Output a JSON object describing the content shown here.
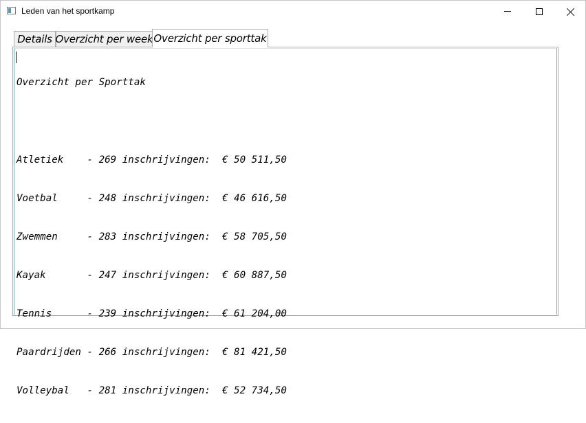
{
  "window": {
    "title": "Leden van het sportkamp",
    "minimize_icon": "minimize-icon",
    "maximize_icon": "maximize-icon",
    "close_icon": "close-icon"
  },
  "tabs": [
    {
      "label": "Details",
      "selected": false
    },
    {
      "label": "Overzicht per week",
      "selected": false
    },
    {
      "label": "Overzicht per sporttak",
      "selected": true
    }
  ],
  "report": {
    "heading": "Overzicht per Sporttak",
    "blank": "",
    "rows": [
      "Atletiek    - 269 inschrijvingen:  € 50 511,50",
      "Voetbal     - 248 inschrijvingen:  € 46 616,50",
      "Zwemmen     - 283 inschrijvingen:  € 58 705,50",
      "Kayak       - 247 inschrijvingen:  € 60 887,50",
      "Tennis      - 239 inschrijvingen:  € 61 204,00",
      "Paardrijden - 266 inschrijvingen:  € 81 421,50",
      "Volleybal   - 281 inschrijvingen:  € 52 734,50"
    ]
  },
  "colors": {
    "tab_border": "#acacac",
    "tab_inactive_bg": "#f0f0f0",
    "textbox_side_border": "#7aa6c8"
  }
}
